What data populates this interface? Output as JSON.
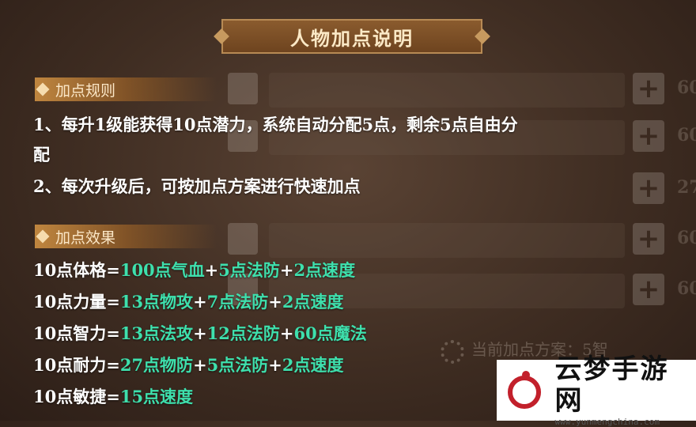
{
  "title": "人物加点说明",
  "rules_header": "加点规则",
  "rules": [
    "1、每升1级能获得10点潜力，系统自动分配5点，剩余5点自由分",
    "配",
    "2、每次升级后，可按加点方案进行快速加点"
  ],
  "effects_header": "加点效果",
  "effects": [
    {
      "stat": "10点体格=",
      "parts": [
        {
          "t": "100点气血",
          "g": true
        },
        {
          "t": "+",
          "g": false
        },
        {
          "t": "5点法防",
          "g": true
        },
        {
          "t": "+",
          "g": false
        },
        {
          "t": "2点速度",
          "g": true
        }
      ]
    },
    {
      "stat": "10点力量=",
      "parts": [
        {
          "t": "13点物攻",
          "g": true
        },
        {
          "t": "+",
          "g": false
        },
        {
          "t": "7点法防",
          "g": true
        },
        {
          "t": "+",
          "g": false
        },
        {
          "t": "2点速度",
          "g": true
        }
      ]
    },
    {
      "stat": "10点智力=",
      "parts": [
        {
          "t": "13点法攻",
          "g": true
        },
        {
          "t": "+",
          "g": false
        },
        {
          "t": "12点法防",
          "g": true
        },
        {
          "t": "+",
          "g": false
        },
        {
          "t": "60点魔法",
          "g": true
        }
      ]
    },
    {
      "stat": "10点耐力=",
      "parts": [
        {
          "t": "27点物防",
          "g": true
        },
        {
          "t": "+",
          "g": false
        },
        {
          "t": "5点法防",
          "g": true
        },
        {
          "t": "+",
          "g": false
        },
        {
          "t": "2点速度",
          "g": true
        }
      ]
    },
    {
      "stat": "10点敏捷=",
      "parts": [
        {
          "t": "15点速度",
          "g": true
        }
      ]
    }
  ],
  "background": {
    "plan_label": "当前加点方案：5智",
    "side_numbers": [
      "60",
      "60",
      "27",
      "60",
      "60"
    ],
    "plus_symbol": "+"
  },
  "watermark": {
    "name": "云梦手游网",
    "url": "www.yunmengchina.com"
  },
  "colors": {
    "highlight": "#3ee0ad",
    "text": "#ffffff",
    "header": "#c0863f"
  }
}
